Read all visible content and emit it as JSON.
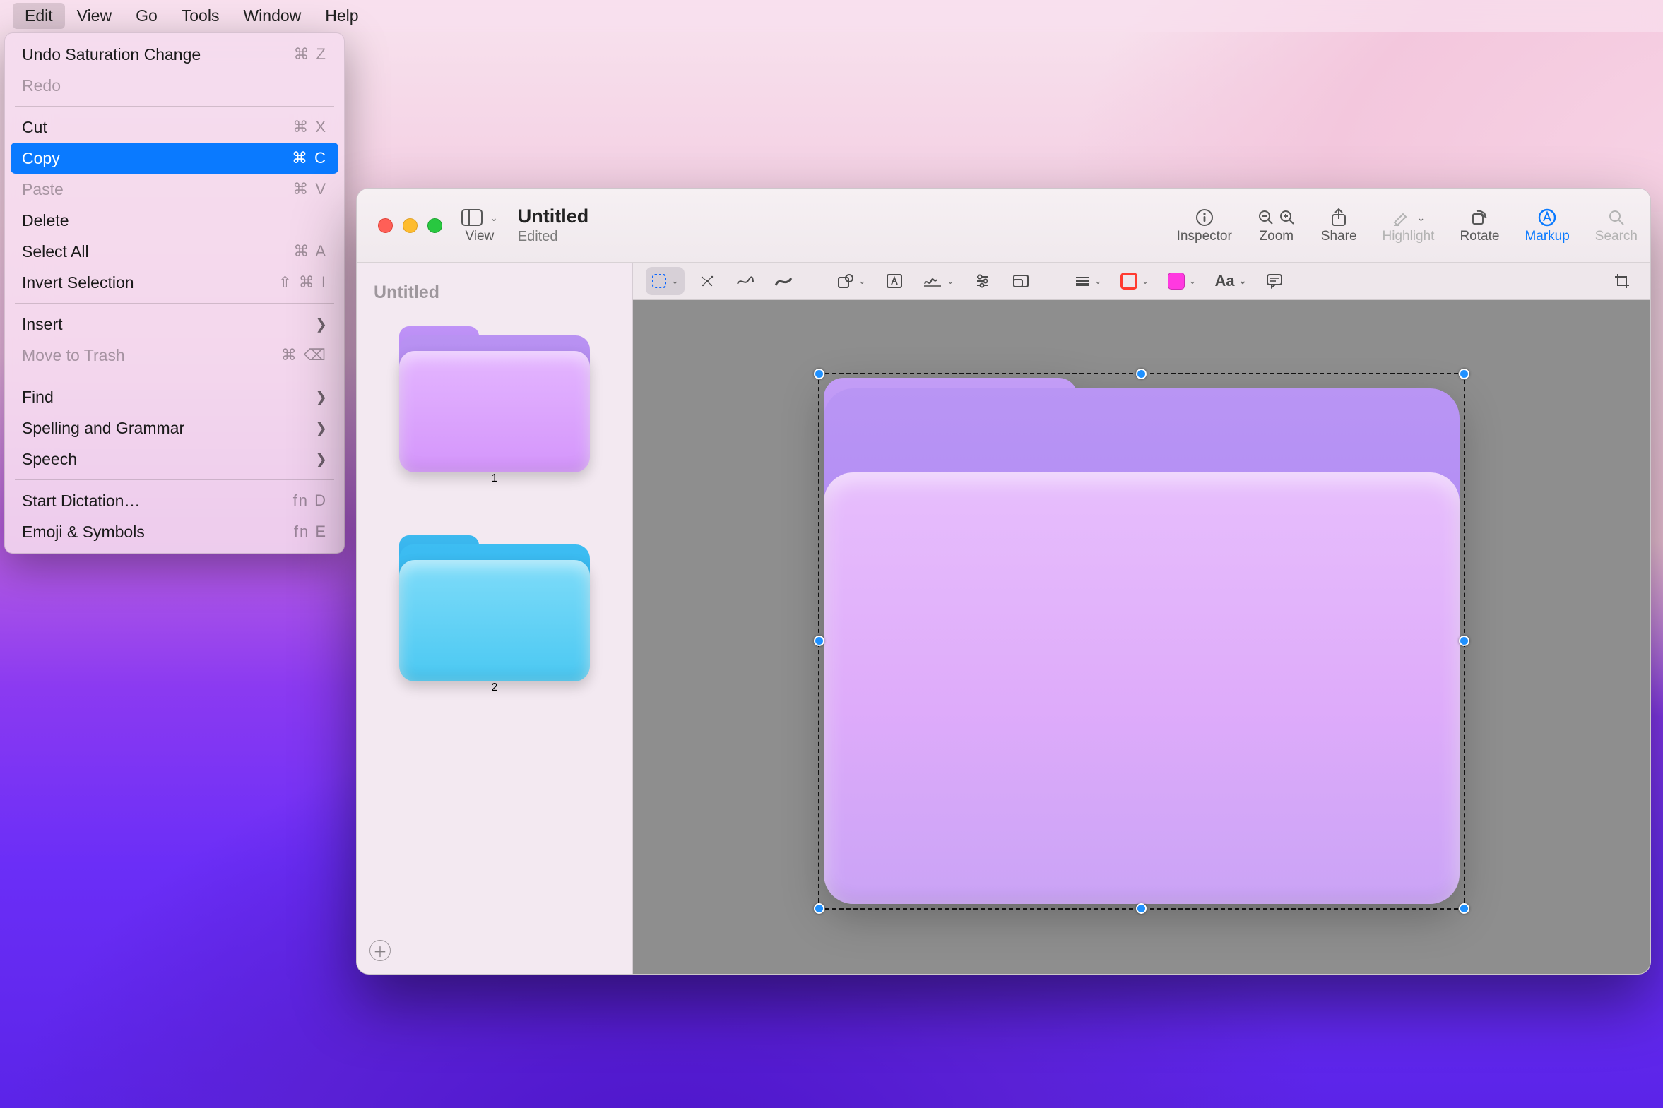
{
  "menubar": {
    "items": [
      "Edit",
      "View",
      "Go",
      "Tools",
      "Window",
      "Help"
    ],
    "active_index": 0
  },
  "edit_menu": {
    "sections": [
      [
        {
          "label": "Undo Saturation Change",
          "shortcut": "⌘ Z",
          "disabled": false
        },
        {
          "label": "Redo",
          "shortcut": "",
          "disabled": true
        }
      ],
      [
        {
          "label": "Cut",
          "shortcut": "⌘ X",
          "disabled": false
        },
        {
          "label": "Copy",
          "shortcut": "⌘ C",
          "disabled": false,
          "selected": true
        },
        {
          "label": "Paste",
          "shortcut": "⌘ V",
          "disabled": true
        },
        {
          "label": "Delete",
          "shortcut": "",
          "disabled": false
        },
        {
          "label": "Select All",
          "shortcut": "⌘ A",
          "disabled": false
        },
        {
          "label": "Invert Selection",
          "shortcut": "⇧ ⌘  I",
          "disabled": false
        }
      ],
      [
        {
          "label": "Insert",
          "submenu": true,
          "disabled": false
        },
        {
          "label": "Move to Trash",
          "shortcut": "⌘ ⌫",
          "disabled": true
        }
      ],
      [
        {
          "label": "Find",
          "submenu": true,
          "disabled": false
        },
        {
          "label": "Spelling and Grammar",
          "submenu": true,
          "disabled": false
        },
        {
          "label": "Speech",
          "submenu": true,
          "disabled": false
        }
      ],
      [
        {
          "label": "Start Dictation…",
          "shortcut": "fn D",
          "disabled": false
        },
        {
          "label": "Emoji & Symbols",
          "shortcut": "fn E",
          "disabled": false
        }
      ]
    ]
  },
  "window": {
    "title": "Untitled",
    "subtitle": "Edited",
    "toolbar": {
      "view": "View",
      "inspector": "Inspector",
      "zoom": "Zoom",
      "share": "Share",
      "highlight": "Highlight",
      "rotate": "Rotate",
      "markup": "Markup",
      "search": "Search"
    }
  },
  "markup_toolbar": {
    "text_style": "Aa"
  },
  "sidebar": {
    "header": "Untitled",
    "pages": [
      {
        "label": "1",
        "color": "purple"
      },
      {
        "label": "2",
        "color": "blue"
      }
    ]
  },
  "colors": {
    "accent": "#0a7aff",
    "markup_fill": "#ff39e0",
    "markup_border": "#ff3b30"
  }
}
